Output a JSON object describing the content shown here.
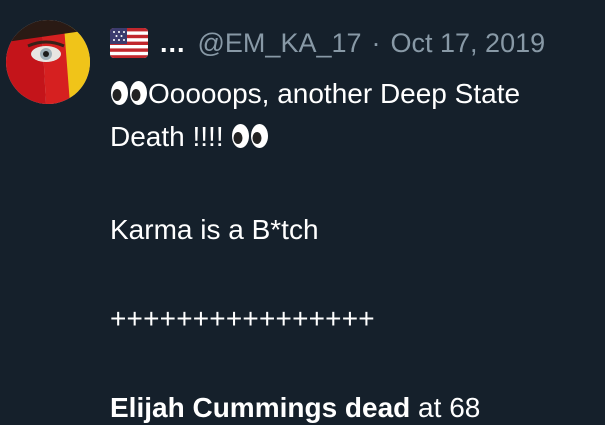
{
  "tweet": {
    "flag_icon": "us-flag-icon",
    "display_name": "...",
    "handle": "@EM_KA_17",
    "separator": "·",
    "date": "Oct 17, 2019",
    "line1_text": "Ooooops, another Deep State",
    "line2_text": "Death !!!! ",
    "eyes_icon": "eyes-emoji-icon",
    "line3_text": "Karma is a B*tch",
    "line4_text": "++++++++++++++++",
    "line5_bold": "Elijah Cummings dead",
    "line5_rest": " at 68"
  }
}
